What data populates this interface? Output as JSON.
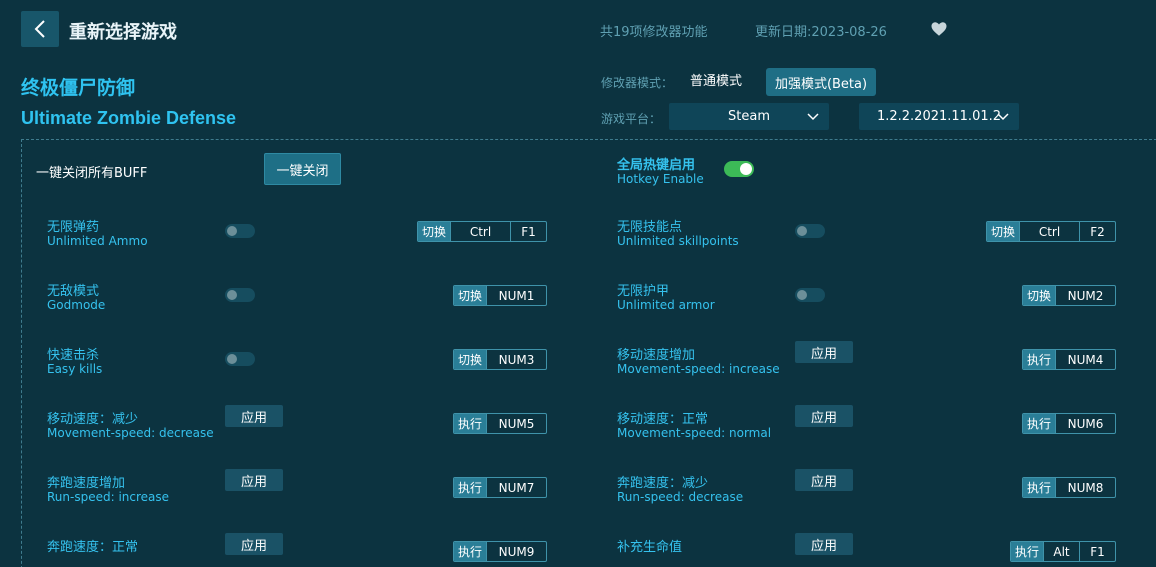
{
  "header": {
    "back_label": "重新选择游戏",
    "feature_count": "共19项修改器功能",
    "update_date": "更新日期:2023-08-26"
  },
  "game": {
    "title_zh": "终极僵尸防御",
    "title_en": "Ultimate Zombie Defense"
  },
  "mode": {
    "label": "修改器模式：",
    "normal": "普通模式",
    "beta": "加强模式(Beta)",
    "selected": "加强模式(Beta)"
  },
  "platform": {
    "label": "游戏平台：",
    "selected": "Steam",
    "version": "1.2.2.2021.11.01.2"
  },
  "global": {
    "disable_all_label": "一键关闭所有BUFF",
    "disable_all_button": "一键关闭",
    "hotkey_zh": "全局热键启用",
    "hotkey_en": "Hotkey Enable",
    "hotkey_enabled": true
  },
  "features": [
    {
      "zh": "无限弹药",
      "en": "Unlimited Ammo",
      "control": "toggle",
      "action": "切换",
      "keys": [
        "Ctrl",
        "F1"
      ]
    },
    {
      "zh": "无限技能点",
      "en": "Unlimited skillpoints",
      "control": "toggle",
      "action": "切换",
      "keys": [
        "Ctrl",
        "F2"
      ]
    },
    {
      "zh": "无敌模式",
      "en": "Godmode",
      "control": "toggle",
      "action": "切换",
      "keys": [
        "NUM1"
      ]
    },
    {
      "zh": "无限护甲",
      "en": "Unlimited armor",
      "control": "toggle",
      "action": "切换",
      "keys": [
        "NUM2"
      ]
    },
    {
      "zh": "快速击杀",
      "en": "Easy kills",
      "control": "toggle",
      "action": "切换",
      "keys": [
        "NUM3"
      ]
    },
    {
      "zh": "移动速度增加",
      "en": "Movement-speed: increase",
      "control": "apply",
      "button": "应用",
      "action": "执行",
      "keys": [
        "NUM4"
      ]
    },
    {
      "zh": "移动速度：减少",
      "en": "Movement-speed: decrease",
      "control": "apply",
      "button": "应用",
      "action": "执行",
      "keys": [
        "NUM5"
      ]
    },
    {
      "zh": "移动速度：正常",
      "en": "Movement-speed: normal",
      "control": "apply",
      "button": "应用",
      "action": "执行",
      "keys": [
        "NUM6"
      ]
    },
    {
      "zh": "奔跑速度增加",
      "en": "Run-speed: increase",
      "control": "apply",
      "button": "应用",
      "action": "执行",
      "keys": [
        "NUM7"
      ]
    },
    {
      "zh": "奔跑速度：减少",
      "en": "Run-speed: decrease",
      "control": "apply",
      "button": "应用",
      "action": "执行",
      "keys": [
        "NUM8"
      ]
    },
    {
      "zh": "奔跑速度：正常",
      "en": "",
      "control": "apply",
      "button": "应用",
      "action": "执行",
      "keys": [
        "NUM9"
      ]
    },
    {
      "zh": "补充生命值",
      "en": "",
      "control": "apply",
      "button": "应用",
      "action": "执行",
      "keys": [
        "Alt",
        "F1"
      ]
    }
  ],
  "icons": {
    "back": "chevron-left-icon",
    "favorite": "heart-icon",
    "dropdown": "chevron-down-icon"
  },
  "colors": {
    "background": "#0c3340",
    "accent": "#2fc3f0",
    "toggle_on": "#3cba57",
    "button": "#1f6e85"
  }
}
